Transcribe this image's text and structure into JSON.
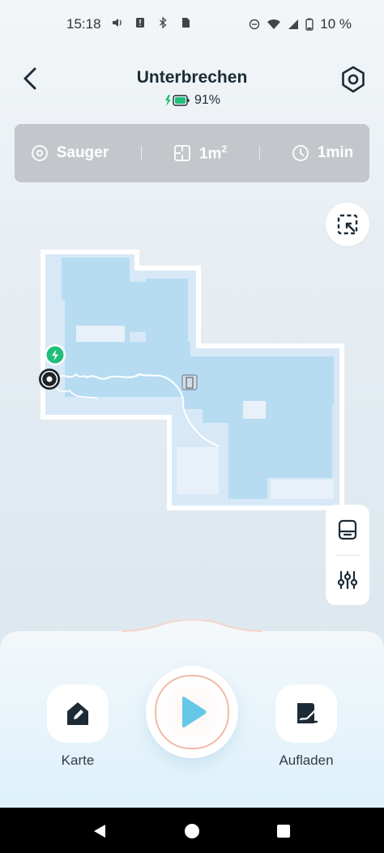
{
  "status_bar": {
    "time": "15:18",
    "battery_percent": "10 %"
  },
  "header": {
    "title": "Unterbrechen",
    "battery": "91%",
    "back_icon": "back-arrow-icon",
    "settings_icon": "settings-gear-icon"
  },
  "info_bar": {
    "mode": "Sauger",
    "area": "1m",
    "area_superscript": "2",
    "time": "1min"
  },
  "actions": {
    "map_label": "Karte",
    "charge_label": "Aufladen"
  },
  "colors": {
    "accent": "#64c8e6",
    "map_fill": "#b7dcf2",
    "charger_green": "#1fbf7a",
    "header_text": "#1d2b36"
  }
}
